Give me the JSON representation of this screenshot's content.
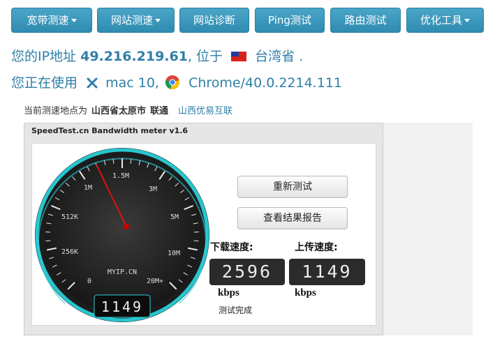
{
  "nav": {
    "items": [
      {
        "label": "宽带测速",
        "dropdown": true
      },
      {
        "label": "网站测速",
        "dropdown": true
      },
      {
        "label": "网站诊断",
        "dropdown": false
      },
      {
        "label": "Ping测试",
        "dropdown": false
      },
      {
        "label": "路由测试",
        "dropdown": false
      },
      {
        "label": "优化工具",
        "dropdown": true
      }
    ]
  },
  "ip_info": {
    "prefix": "您的IP地址",
    "ip": "49.216.219.61",
    "located_at": ", 位于",
    "region": "台湾省",
    "suffix": "."
  },
  "browser_info": {
    "prefix": "您正在使用",
    "os": "mac 10,",
    "browser": "Chrome/40.0.2214.111",
    "os_icon": "x-icon",
    "browser_icon": "chrome-icon"
  },
  "test_node": {
    "label": "当前测速地点为",
    "place": "山西省太原市",
    "isp": "联通",
    "provider_link": "山西优易互联"
  },
  "meter": {
    "title": "SpeedTest.cn Bandwidth meter v1.6",
    "scale_labels": [
      "0",
      "256K",
      "512K",
      "1M",
      "1.5M",
      "3M",
      "5M",
      "10M",
      "20M+"
    ],
    "brand": "MYIP.CN",
    "needle_value": "1149",
    "retest_button": "重新测试",
    "report_button": "查看结果报告",
    "download_label": "下载速度:",
    "upload_label": "上传速度:",
    "download_value": "2596",
    "upload_value": "1149",
    "download_unit": "kbps",
    "upload_unit": "kbps",
    "status": "测试完成"
  },
  "colors": {
    "nav_button": "#3a97bd",
    "info_text": "#2f7fa8",
    "gauge_accent": "#2fd0d8",
    "needle": "#e01010"
  }
}
